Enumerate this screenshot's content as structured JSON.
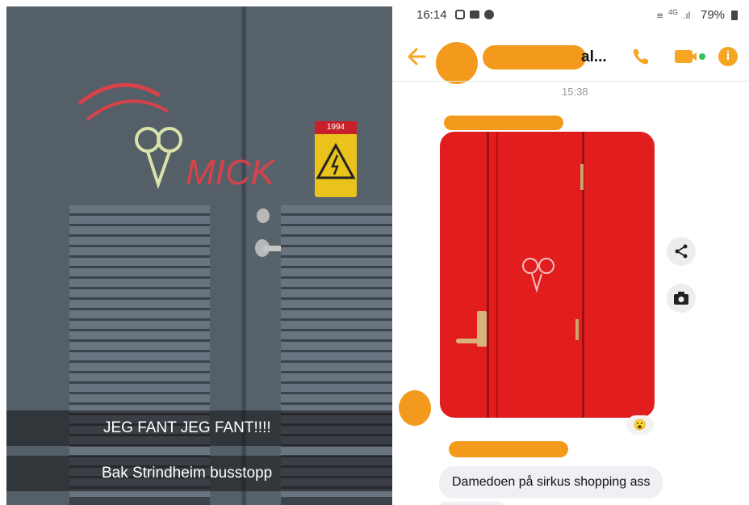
{
  "snap": {
    "caption_main": "JEG FANT JEG FANT!!!!",
    "caption_location": "Bak Strindheim busstopp",
    "graffiti_text": "MICK",
    "sign_number": "1994"
  },
  "messenger": {
    "status_time": "16:14",
    "status_network": "4G",
    "battery": "79%",
    "contact_name_suffix": "al...",
    "message_time": "15:38",
    "reaction": "😮",
    "reply_text": "Damedoen på sirkus shopping ass",
    "colors": {
      "accent": "#f5a623",
      "red_door": "#e21d1d",
      "active_dot": "#31c45b"
    }
  }
}
